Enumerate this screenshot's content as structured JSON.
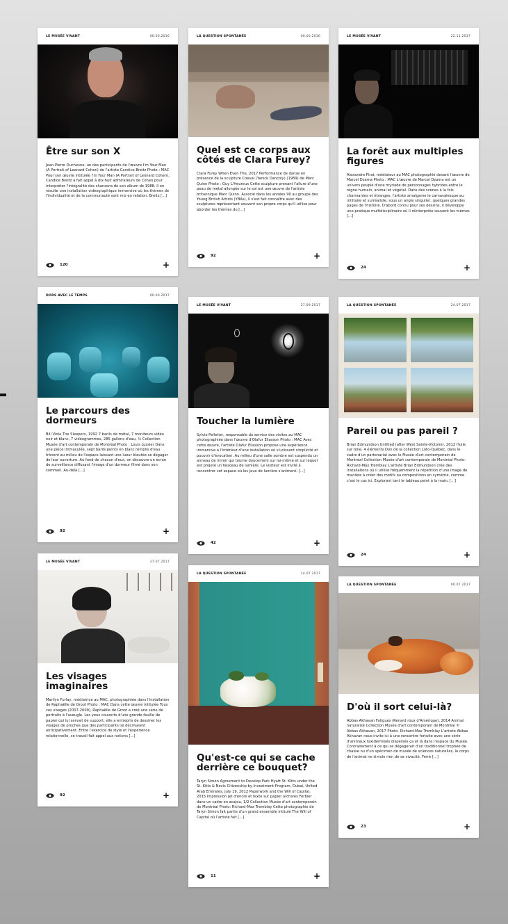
{
  "cards": [
    {
      "category": "LE MUSÉE VIVANT",
      "date": "00.00.2016",
      "title": "Être sur son X",
      "excerpt": "Jean-Pierre Duchesne, un des participants de l'œuvre I'm Your Man (A Portrait of Leonard Cohen) de l'artiste Candice Breitz Photo : MAC Pour son œuvre intitulée I'm Your Man (A Portrait of Leonard Cohen), Candice Breitz a fait appel à dix-huit admirateurs de Cohen pour interpréter l'intégralité des chansons de son album de 1988. Il en résulte une installation vidéographique immersive où les thèmes de l'individualité et de la communauté sont mis en relation. Breitz [...]",
      "views": "120"
    },
    {
      "category": "LA QUESTION SPONTANÉE",
      "date": "00.00.2016",
      "title": "Quel est ce corps aux côtés de Clara Furey?",
      "excerpt": "Clara Furey When Even The, 2017 Performance de danse en présence de la sculpture Coeval (Yanick Dancoly) (1989) de Marc Quinn Photo : Guy L'Heureux Cette sculpture prenant l'allure d'une peau de métal allongée sur le sol est une œuvre de l'artiste britannique Marc Quinn. Associé dans les années 90 au groupe des Young British Artists (YBAs), il s'est fait connaître avec des sculptures représentant souvent son propre corps qu'il utilise pour aborder les thèmes du [...]",
      "views": "92"
    },
    {
      "category": "LE MUSÉE VIVANT",
      "date": "22.11.2017",
      "title": "La forêt aux multiples figures",
      "excerpt": "Alexandre Pirat, médiateur au MAC photographié devant l'œuvre de Marcel Dzama Photo : MAC L'œuvre de Marcel Dzama est un univers peuplé d'une myriade de personnages hybrides entre le règne humain, animal et végétal. Dans des scènes à la fois charmantes et étranges, l'artiste amalgame le carnavalesque au militaire et surréaliste, sous un angle singulier, quelques grandes pages de l'histoire. D'abord connu pour ses dessins, il développe une pratique multidisciplinaire où il réinterprète souvent les mêmes [...]",
      "views": "24"
    },
    {
      "category": "DORS AVEC LE TEMPS",
      "date": "00.00.2017",
      "title": "Le parcours des dormeurs",
      "excerpt": "Bill Viola The Sleepers, 1992 7 barils de métal, 7 moniteurs vidéo noir et blanc, 7 vidéogrammes, 285 gallons d'eau, ½ Collection Musée d'art contemporain de Montréal Photo : Louis Lussier Dans une pièce immaculée, sept barils peints en blanc remplis d'eau trônent au milieu de l'espace laissant une lueur bleutée se dégager de leur ouverture. Au fond de chacun d'eux, on découvre un écran de surveillance diffusant l'image d'un dormeur filmé dans son sommeil. Au-delà [...]",
      "views": "92"
    },
    {
      "category": "LE MUSÉE VIVANT",
      "date": "27.09.2017",
      "title": "Toucher la lumière",
      "excerpt": "Sylvie Pelletier, responsable du service des visites au MAC photographiée dans l'œuvre d'Olafur Eliasson Photo : MAC Avec cette œuvre, l'artiste Olafur Eliasson propose une expérience immersive à l'intérieur d'une installation où s'unissent simplicité et pouvoir d'évocation. Au milieu d'une salle sombre est suspendu un anneau de miroir qui tourne doucement sur lui-même et sur lequel est projeté un faisceau de lumière. Le visiteur est invité à rencontrer cet espace où les jeux de lumière s'animent. [...]",
      "views": "42"
    },
    {
      "category": "LA QUESTION SPONTANÉE",
      "date": "24.07.2017",
      "title": "Pareil ou pas pareil ?",
      "excerpt": "Brian Edmundson Untitled (after West Sainte-Victoire), 2012 Huile sur toile, 4 éléments Don de la collection Loto-Québec, dans le cadre d'un partenariat avec le Musée d'art contemporain de Montréal Collection Musée d'art contemporain de Montréal Photo: Richard-Max Tremblay L'artiste Brian Edmundson crée des installations où il utilise fréquemment la répétition d'une image de manière à créer des motifs ou compositions en symétrie, comme c'est le cas ici. Explorant tant le tableau peint à la main, [...]",
      "views": "24"
    },
    {
      "category": "LE MUSÉE VIVANT",
      "date": "27.07.2017",
      "title": "Les visages imaginaires",
      "excerpt": "Marilyn Furlay, médiatrice au MAC, photographiée dans l'installation de Raphaëlle de Groot Photo : MAC Dans cette œuvre intitulée Tous ces visages (2007-2009), Raphaëlle de Groot a créé une série de portraits à l'aveugle. Les yeux couverts d'une grande feuille de papier qui lui servait de support, elle a entrepris de dessiner les visages de proches que des participants lui décrivaient anticipativement. Entre l'exercice de style et l'expérience relationnelle, ce travail fait appel aux notions [...]",
      "views": "92"
    },
    {
      "category": "LA QUESTION SPONTANÉE",
      "date": "14.07.2017",
      "title": "Qu'est-ce qui se cache derrière ce bouquet?",
      "excerpt": "Taryn Simon Agreement to Develop Park Hyatt St. Kitts under the St. Kitts & Nevis Citizenship by Investment Program, Dubai, United Arab Emirates, July 19, 2012 Paperwork and the Will of Capital, 2015 Impression jet d'encre et texte sur papier archives Ferbier dans un cadre en acajou, 1/2 Collection Musée d'art contemporain de Montréal Photo: Richard-Max Tremblay Cette photographie de Taryn Simon fait partie d'un grand ensemble intitulé The Will of Capital où l'artiste fait [...]",
      "views": "11"
    },
    {
      "category": "LA QUESTION SPONTANÉE",
      "date": "00.07.2017",
      "title": "D'où il sort celui-là?",
      "excerpt": "Abbas Akhavan Fatigues (Renard roux d'Amérique), 2014 Animal naturalisé Collection Musée d'art contemporain de Montréal © Abbas Akhavan, 2017 Photo: Richard-Max Tremblay L'artiste Abbas Akhavan nous invite ici à une rencontre fortuite avec une série d'animaux taxidermisés dispersés ça et là dans l'espace du Musée. Contrairement à ce qui se dégagerait d'un traditionnel trophée de chasse ou d'un spécimen de musée de sciences naturelles, le corps de l'animal ne simule rien de sa vivacité. Ferré [...]",
      "views": "23"
    }
  ],
  "icons": {
    "views": "eye-icon",
    "expand": "plus-icon"
  },
  "colors": {
    "background_top": "#e2e2e2",
    "background_bottom": "#a3a3a3",
    "card": "#ffffff",
    "text": "#141414"
  }
}
